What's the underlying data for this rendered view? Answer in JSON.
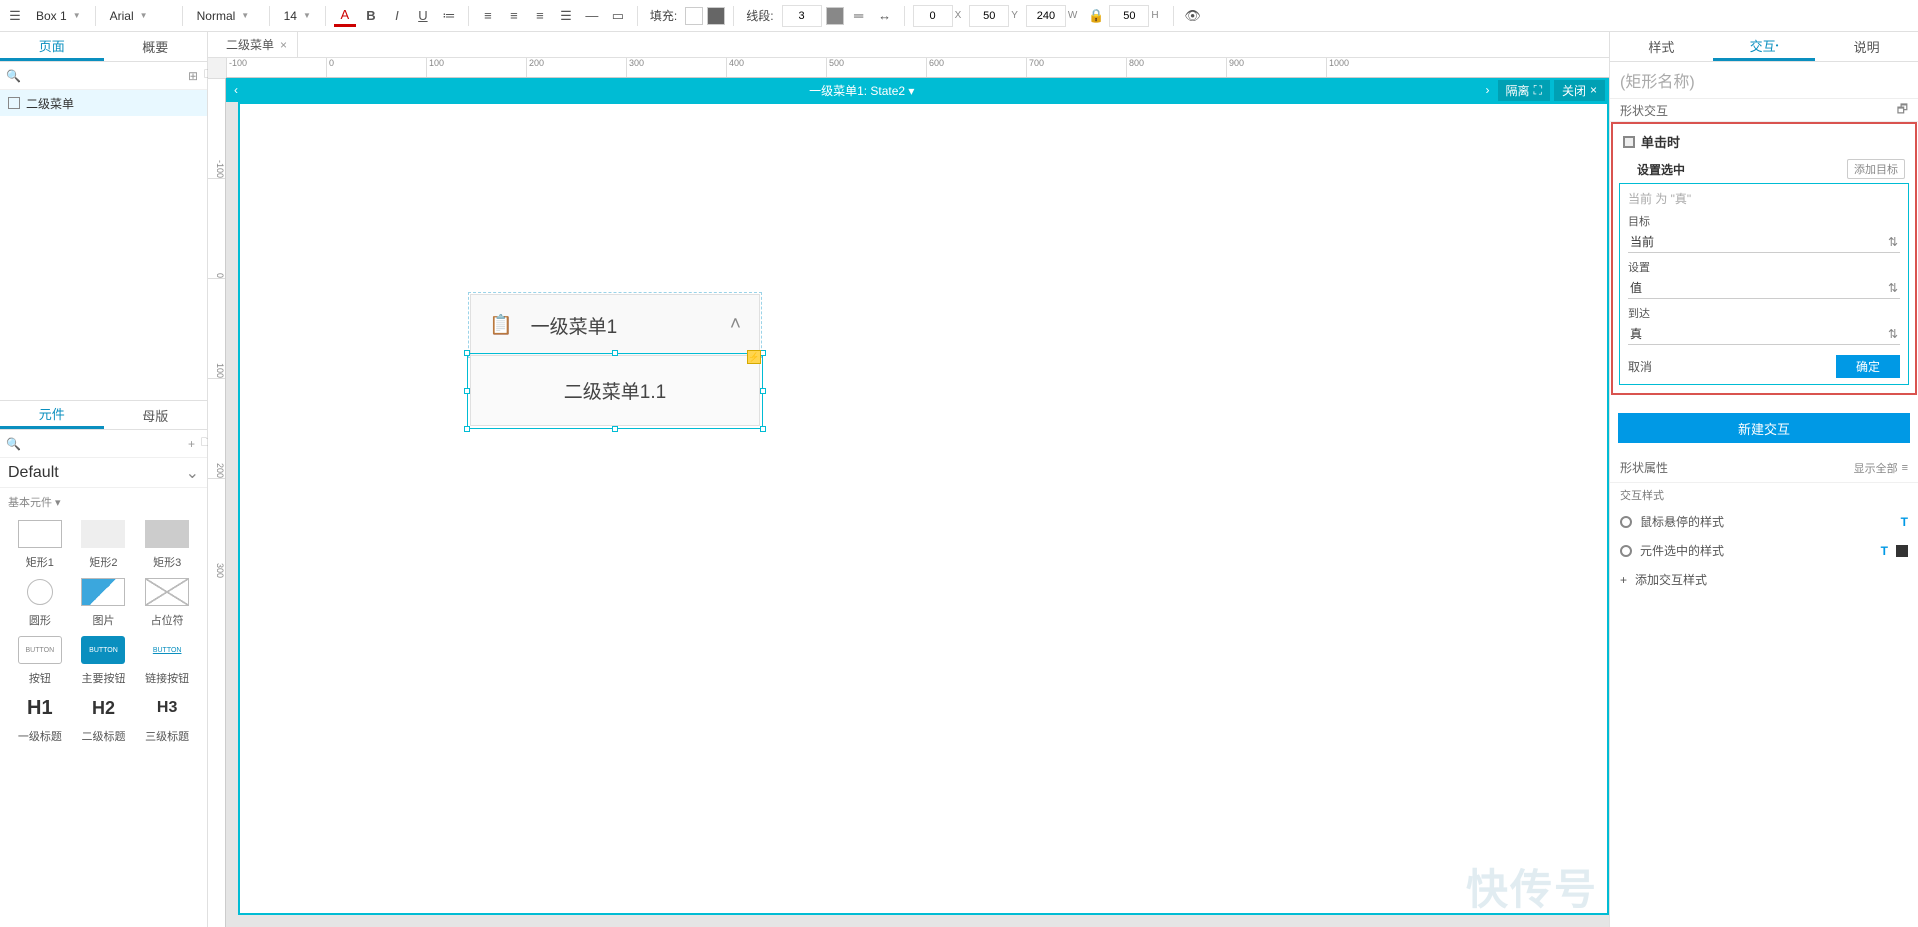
{
  "toolbar": {
    "widget_name": "Box 1",
    "font": "Arial",
    "style": "Normal",
    "size": "14",
    "fill_label": "填充:",
    "line_label": "线段:",
    "line_width": "3",
    "x": "0",
    "x_suffix": "X",
    "y": "50",
    "y_suffix": "Y",
    "w": "240",
    "w_suffix": "W",
    "h": "50",
    "h_suffix": "H"
  },
  "left": {
    "tabs": {
      "pages": "页面",
      "outline": "概要"
    },
    "tree_item": "二级菜单",
    "widgets_tabs": {
      "widgets": "元件",
      "masters": "母版"
    },
    "library": "Default",
    "section": "基本元件 ▾",
    "items": {
      "rect1": "矩形1",
      "rect2": "矩形2",
      "rect3": "矩形3",
      "circle": "圆形",
      "image": "图片",
      "placeholder": "占位符",
      "button": "按钮",
      "primary": "主要按钮",
      "link": "链接按钮",
      "h1": "一级标题",
      "h2": "二级标题",
      "h3": "三级标题"
    },
    "thumbs": {
      "button": "BUTTON",
      "h1": "H1",
      "h2": "H2",
      "h3": "H3"
    }
  },
  "canvas": {
    "tab": "二级菜单",
    "page_title": "一级菜单1: State2 ▾",
    "btn_isolate": "隔离",
    "btn_close": "关闭",
    "menu1": "一级菜单1",
    "menu1_1": "二级菜单1.1",
    "ruler_h": [
      "-100",
      "0",
      "100",
      "200",
      "300",
      "400",
      "500",
      "600",
      "700",
      "800",
      "900",
      "1000"
    ],
    "ruler_v": [
      "-100",
      "0",
      "100",
      "200",
      "300"
    ]
  },
  "right": {
    "tabs": {
      "style": "样式",
      "interact": "交互",
      "notes": "说明"
    },
    "name_placeholder": "(矩形名称)",
    "shape_ix": "形状交互",
    "event": "单击时",
    "action": "设置选中",
    "add_target": "添加目标",
    "hint": "当前 为 \"真\"",
    "label_target": "目标",
    "val_target": "当前",
    "label_set": "设置",
    "val_set": "值",
    "label_to": "到达",
    "val_to": "真",
    "cancel": "取消",
    "ok": "确定",
    "new_interaction": "新建交互",
    "shape_props": "形状属性",
    "show_all": "显示全部",
    "ix_styles": "交互样式",
    "hover_style": "鼠标悬停的样式",
    "selected_style": "元件选中的样式",
    "add_ix_style": "添加交互样式"
  },
  "watermark": "快传号"
}
